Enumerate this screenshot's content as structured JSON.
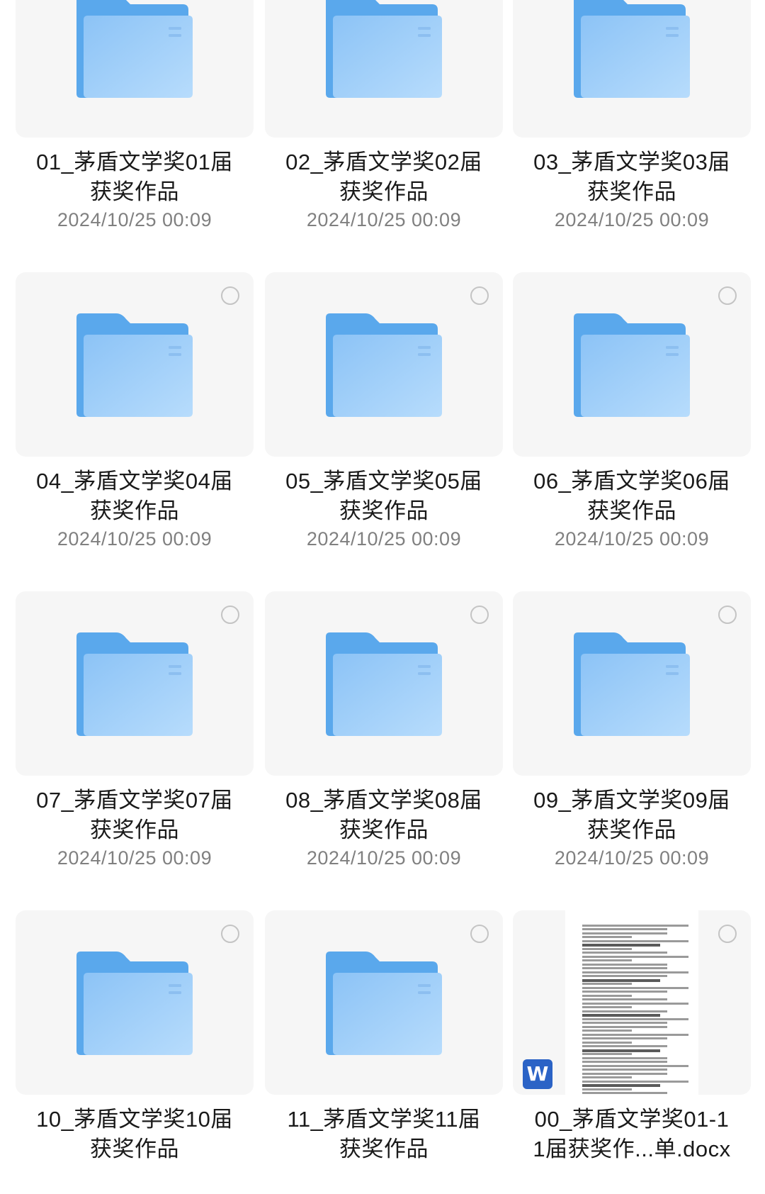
{
  "icons": {
    "folder": "folder-icon",
    "select": "select-circle-icon",
    "word": "word-doc-icon"
  },
  "colors": {
    "folder_back": "#5aa8ec",
    "folder_front": "#a9d4fb",
    "tile_bg": "#f6f6f6",
    "word_badge": "#2b63c6"
  },
  "items": [
    {
      "type": "folder",
      "line1": "01_茅盾文学奖01届",
      "line2": "获奖作品",
      "date": "2024/10/25 00:09"
    },
    {
      "type": "folder",
      "line1": "02_茅盾文学奖02届",
      "line2": "获奖作品",
      "date": "2024/10/25 00:09"
    },
    {
      "type": "folder",
      "line1": "03_茅盾文学奖03届",
      "line2": "获奖作品",
      "date": "2024/10/25 00:09"
    },
    {
      "type": "folder",
      "line1": "04_茅盾文学奖04届",
      "line2": "获奖作品",
      "date": "2024/10/25 00:09"
    },
    {
      "type": "folder",
      "line1": "05_茅盾文学奖05届",
      "line2": "获奖作品",
      "date": "2024/10/25 00:09"
    },
    {
      "type": "folder",
      "line1": "06_茅盾文学奖06届",
      "line2": "获奖作品",
      "date": "2024/10/25 00:09"
    },
    {
      "type": "folder",
      "line1": "07_茅盾文学奖07届",
      "line2": "获奖作品",
      "date": "2024/10/25 00:09"
    },
    {
      "type": "folder",
      "line1": "08_茅盾文学奖08届",
      "line2": "获奖作品",
      "date": "2024/10/25 00:09"
    },
    {
      "type": "folder",
      "line1": "09_茅盾文学奖09届",
      "line2": "获奖作品",
      "date": "2024/10/25 00:09"
    },
    {
      "type": "folder",
      "line1": "10_茅盾文学奖10届",
      "line2": "获奖作品",
      "date": ""
    },
    {
      "type": "folder",
      "line1": "11_茅盾文学奖11届",
      "line2": "获奖作品",
      "date": ""
    },
    {
      "type": "docx",
      "line1": "00_茅盾文学奖01-1",
      "line2": "1届获奖作...单.docx",
      "date": "",
      "badge": "W"
    }
  ]
}
